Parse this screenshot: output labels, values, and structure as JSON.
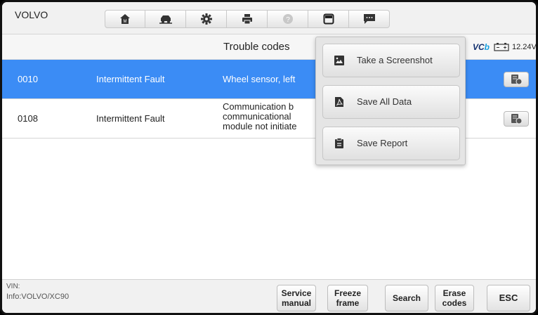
{
  "header": {
    "brand": "VOLVO",
    "toolbar_icons": [
      "home-icon",
      "vehicle-swap-icon",
      "gear-icon",
      "printer-icon",
      "help-icon",
      "save-icon",
      "message-icon"
    ]
  },
  "title_bar": {
    "title": "Trouble codes",
    "vci_label": "VC",
    "vci_suffix": "b",
    "voltage": "12.24V"
  },
  "codes": [
    {
      "code": "0010",
      "status": "Intermittent Fault",
      "description": "Wheel sensor, left"
    },
    {
      "code": "0108",
      "status": "Intermittent Fault",
      "description_lines": [
        "Communication b",
        "communicational",
        "module not initiate"
      ]
    }
  ],
  "save_menu": {
    "items": [
      {
        "label": "Take a Screenshot",
        "icon": "image-icon"
      },
      {
        "label": "Save All Data",
        "icon": "pdf-icon"
      },
      {
        "label": "Save Report",
        "icon": "report-icon"
      }
    ]
  },
  "footer": {
    "vin_label": "VIN:",
    "info_label": "Info:VOLVO/XC90",
    "buttons": {
      "service_manual": "Service\nmanual",
      "freeze_frame": "Freeze\nframe",
      "search": "Search",
      "erase_codes": "Erase\ncodes",
      "esc": "ESC"
    }
  },
  "colors": {
    "selected_row": "#3b8cf5",
    "vci_dark": "#12306f",
    "vci_accent": "#16a0e0"
  }
}
